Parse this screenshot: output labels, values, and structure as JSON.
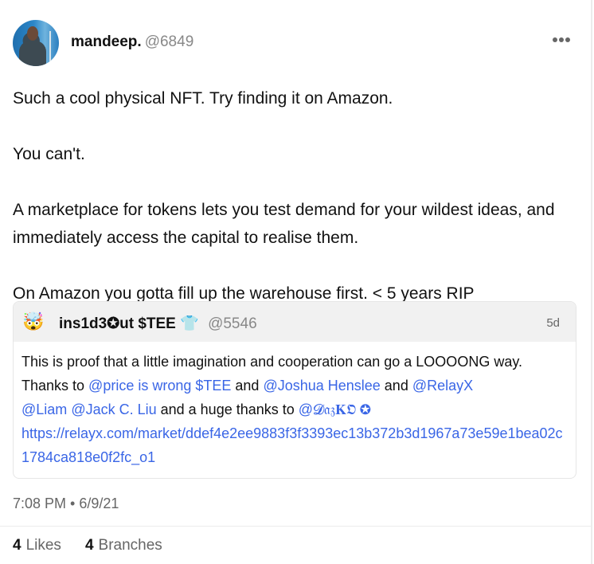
{
  "author": {
    "name": "mandeep.",
    "handle": "@6849",
    "avatar_icon": "user-photo"
  },
  "menu_icon": "more-horizontal-icon",
  "post": {
    "paragraphs": [
      "Such a cool physical NFT. Try finding it on Amazon.",
      "You can't.",
      "A marketplace for tokens lets you test demand for your wildest ideas, and immediately access the capital to realise them.",
      "On Amazon you gotta fill up the warehouse first. < 5 years RIP"
    ]
  },
  "quote": {
    "avatar_emoji": "🤯",
    "name": "ins1d3✪ut $TEE",
    "name_emoji": "👕",
    "handle": "@5546",
    "time": "5d",
    "text_1": "This is proof that a little imagination and cooperation can go a LOOOONG way. Thanks to ",
    "mention_1": "@price is wrong $TEE",
    "text_2": " and ",
    "mention_2": "@Joshua Henslee",
    "text_3": " and ",
    "mention_3": "@RelayX",
    "text_4": " ",
    "mention_4": "@Liam",
    "text_5": " ",
    "mention_5": "@Jack C. Liu",
    "text_6": " and a huge thanks to ",
    "mention_6": "@𝓓𝔞𝔷𝐊𝕺 ✪",
    "url": "https://relayx.com/market/ddef4e2ee9883f3f3393ec13b372b3d1967a73e59e1bea02c1784ca818e0f2fc_o1"
  },
  "timestamp": "7:08 PM • 6/9/21",
  "stats": {
    "likes_count": "4",
    "likes_label": "Likes",
    "branches_count": "4",
    "branches_label": "Branches"
  }
}
